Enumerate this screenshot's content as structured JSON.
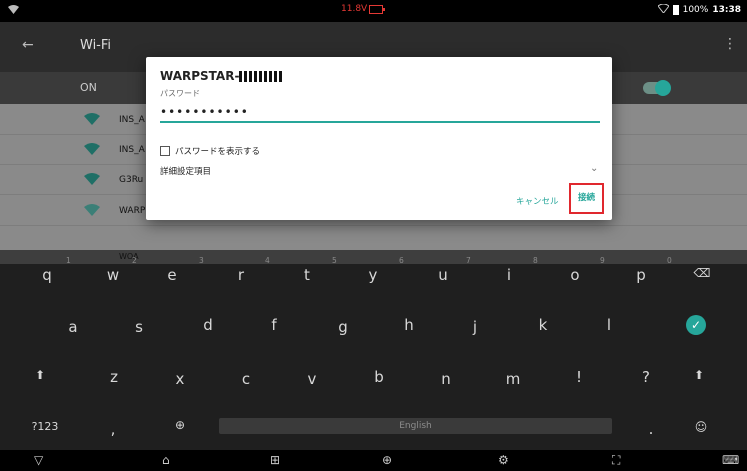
{
  "status": {
    "voltage": "11.8V",
    "battery": "100%",
    "time": "13:38"
  },
  "appbar": {
    "title": "Wi-Fi"
  },
  "onrow": {
    "label": "ON"
  },
  "networks": [
    "INS_A",
    "INS_A",
    "G3Ru",
    "WARP",
    "WOA"
  ],
  "dialog": {
    "ssid": "WARPSTAR-",
    "password_label": "パスワード",
    "password_value": "•••••••••••",
    "show_password": "パスワードを表示する",
    "advanced": "詳細設定項目",
    "cancel": "キャンセル",
    "connect": "接続"
  },
  "keyboard": {
    "row1": [
      "q",
      "w",
      "e",
      "r",
      "t",
      "y",
      "u",
      "i",
      "o",
      "p"
    ],
    "row1_hints": [
      "1",
      "2",
      "3",
      "4",
      "5",
      "6",
      "7",
      "8",
      "9",
      "0"
    ],
    "row2": [
      "a",
      "s",
      "d",
      "f",
      "g",
      "h",
      "j",
      "k",
      "l"
    ],
    "row3": [
      "z",
      "x",
      "c",
      "v",
      "b",
      "n",
      "m",
      "!",
      "?"
    ],
    "symbols": "?123",
    "comma": ",",
    "period": ".",
    "space": "English"
  }
}
